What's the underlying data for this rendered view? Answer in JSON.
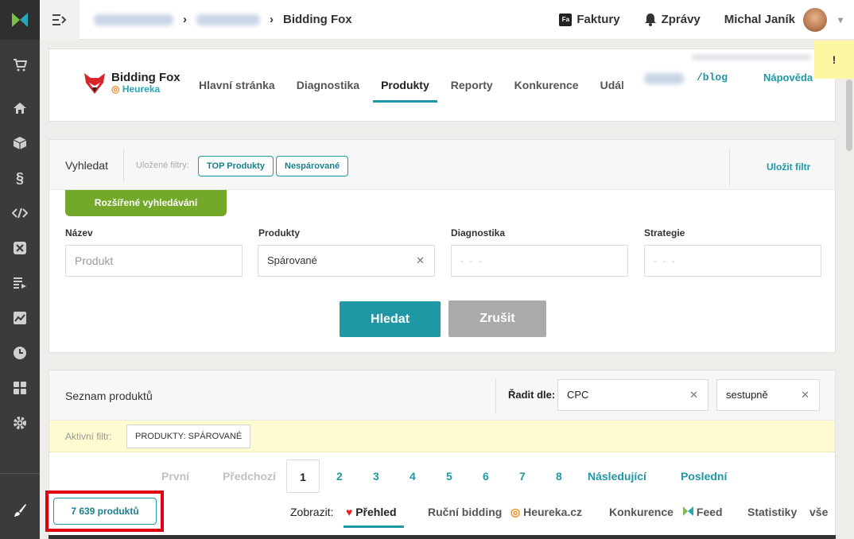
{
  "topbar": {
    "breadcrumb_current": "Bidding Fox",
    "invoices": "Faktury",
    "messages": "Zprávy",
    "user_name": "Michal Janík"
  },
  "app": {
    "brand_name": "Bidding Fox",
    "brand_sub": "Heureka",
    "nav": [
      "Hlavní stránka",
      "Diagnostika",
      "Produkty",
      "Reporty",
      "Konkurence",
      "Udál"
    ],
    "active_nav": "Produkty",
    "blog": "/blog",
    "help": "Nápověda",
    "alert": "!"
  },
  "search": {
    "title": "Vyhledat",
    "saved_filters_label": "Uložené filtry:",
    "saved_filters": [
      "TOP Produkty",
      "Nespárované"
    ],
    "save_filter": "Uložit filtr",
    "advanced": "Rozšířené vyhledávání",
    "fields": [
      {
        "label": "Název",
        "placeholder": "Produkt",
        "value": ""
      },
      {
        "label": "Produkty",
        "placeholder": "",
        "value": "Spárované"
      },
      {
        "label": "Diagnostika",
        "placeholder": "- - -",
        "value": ""
      },
      {
        "label": "Strategie",
        "placeholder": "- - -",
        "value": ""
      }
    ],
    "search_button": "Hledat",
    "cancel_button": "Zrušit"
  },
  "products": {
    "title": "Seznam produktů",
    "sort_label": "Řadit dle:",
    "sort_by": "CPC",
    "sort_dir": "sestupně",
    "active_filter_label": "Aktivní filtr:",
    "active_filter": "PRODUKTY: SPÁROVANÉ",
    "pager": {
      "first": "První",
      "prev": "Předchozí",
      "pages": [
        "1",
        "2",
        "3",
        "4",
        "5",
        "6",
        "7",
        "8"
      ],
      "current": "1",
      "next": "Následující",
      "last": "Poslední"
    },
    "count": "7 639 produktů",
    "show_label": "Zobrazit:",
    "views": [
      "Přehled",
      "Ruční bidding",
      "Heureka.cz",
      "Konkurence",
      "Feed",
      "Statistiky",
      "vše"
    ],
    "active_view": "Přehled"
  },
  "colors": {
    "accent": "#1f98a6",
    "green": "#74a82a",
    "sidebar": "#3b3b3b",
    "highlight": "#e00012"
  }
}
